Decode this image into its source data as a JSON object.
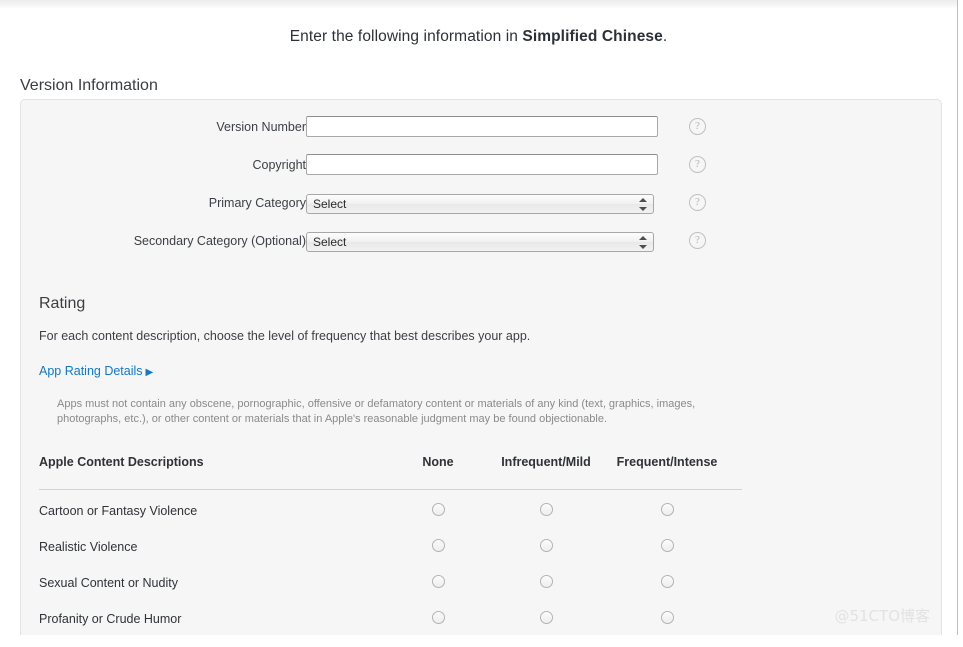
{
  "page": {
    "heading_prefix": "Enter the following information in ",
    "heading_bold": "Simplified Chinese",
    "heading_suffix": ".",
    "watermark": "@51CTO博客",
    "accent_link_color": "#1278c8",
    "panel_background": "#f6f6f6"
  },
  "version_information": {
    "section_title": "Version Information",
    "fields": [
      {
        "label": "Version Number",
        "type": "text",
        "value": "",
        "placeholder": "",
        "help": "?"
      },
      {
        "label": "Copyright",
        "type": "text",
        "value": "",
        "placeholder": "",
        "help": "?"
      },
      {
        "label": "Primary Category",
        "type": "select",
        "value": "Select",
        "help": "?"
      },
      {
        "label": "Secondary Category (Optional)",
        "type": "select",
        "value": "Select",
        "help": "?"
      }
    ]
  },
  "rating": {
    "title": "Rating",
    "description": "For each content description, choose the level of frequency that best describes your app.",
    "details_link": "App Rating Details",
    "details_link_arrow": "▶",
    "disclaimer": "Apps must not contain any obscene, pornographic, offensive or defamatory content or materials of any kind (text, graphics, images, photographs, etc.), or other content or materials that in Apple's reasonable judgment may be found objectionable.",
    "table": {
      "header_description": "Apple Content Descriptions",
      "columns": [
        "None",
        "Infrequent/Mild",
        "Frequent/Intense"
      ],
      "rows": [
        {
          "label": "Cartoon or Fantasy Violence",
          "selected": null
        },
        {
          "label": "Realistic Violence",
          "selected": null
        },
        {
          "label": "Sexual Content or Nudity",
          "selected": null
        },
        {
          "label": "Profanity or Crude Humor",
          "selected": null
        }
      ]
    }
  }
}
